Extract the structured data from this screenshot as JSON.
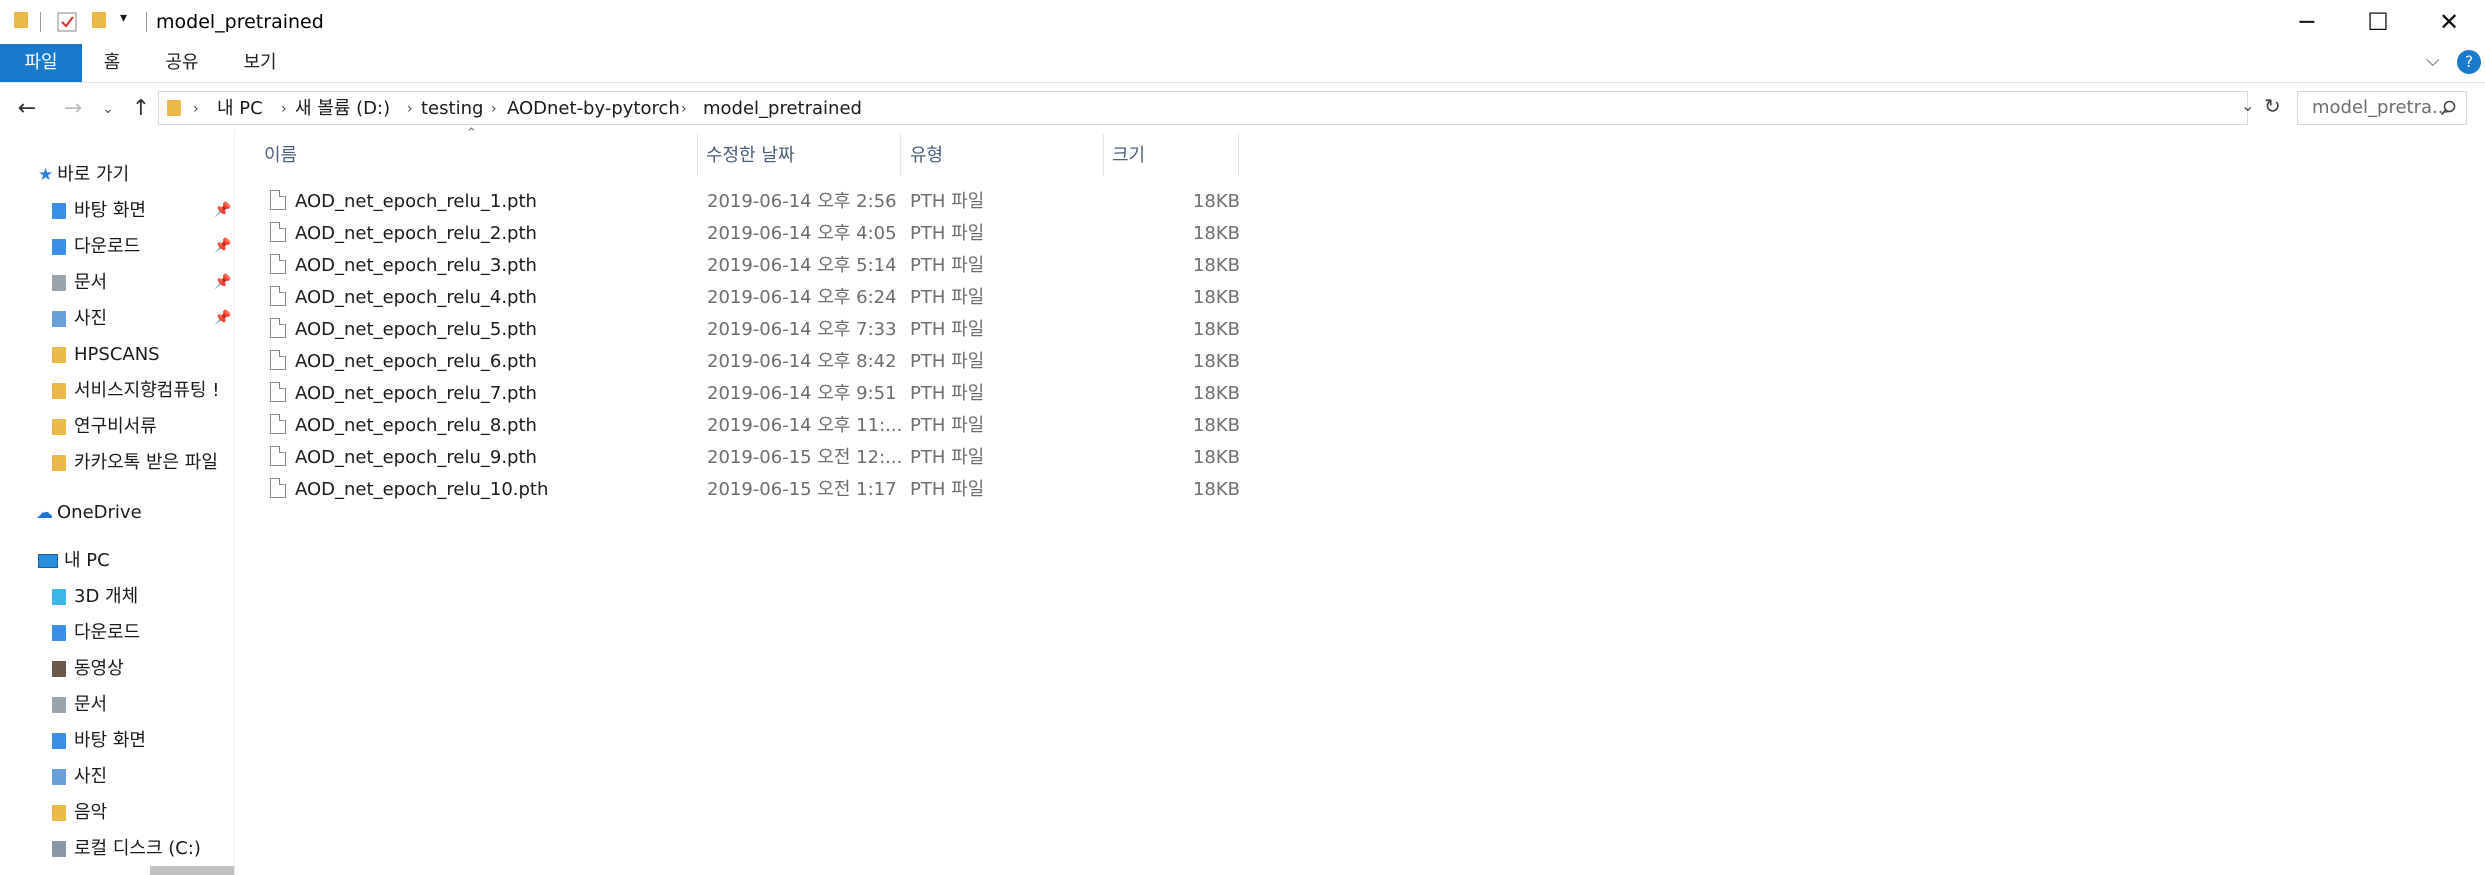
{
  "window": {
    "title": "model_pretrained"
  },
  "ribbon": {
    "tabs": [
      "파일",
      "홈",
      "공유",
      "보기"
    ]
  },
  "address": {
    "path": [
      "내 PC",
      "새 볼륨 (D:)",
      "testing",
      "AODnet-by-pytorch",
      "model_pretrained"
    ]
  },
  "search": {
    "placeholder": "model_pretra..."
  },
  "sidebar": {
    "quick_access_label": "바로 가기",
    "quick_items": [
      "바탕 화면",
      "다운로드",
      "문서",
      "사진",
      "HPSCANS",
      "서비스지향컴퓨팅 !",
      "연구비서류",
      "카카오톡 받은 파일"
    ],
    "onedrive_label": "OneDrive",
    "pc_label": "내 PC",
    "pc_items": [
      "3D 개체",
      "다운로드",
      "동영상",
      "문서",
      "바탕 화면",
      "사진",
      "음악",
      "로컬 디스크 (C:)"
    ]
  },
  "columns": {
    "name": "이름",
    "date": "수정한 날짜",
    "type": "유형",
    "size": "크기"
  },
  "files": [
    {
      "name": "AOD_net_epoch_relu_1.pth",
      "date": "2019-06-14 오후 2:56",
      "type": "PTH 파일",
      "size": "18KB"
    },
    {
      "name": "AOD_net_epoch_relu_2.pth",
      "date": "2019-06-14 오후 4:05",
      "type": "PTH 파일",
      "size": "18KB"
    },
    {
      "name": "AOD_net_epoch_relu_3.pth",
      "date": "2019-06-14 오후 5:14",
      "type": "PTH 파일",
      "size": "18KB"
    },
    {
      "name": "AOD_net_epoch_relu_4.pth",
      "date": "2019-06-14 오후 6:24",
      "type": "PTH 파일",
      "size": "18KB"
    },
    {
      "name": "AOD_net_epoch_relu_5.pth",
      "date": "2019-06-14 오후 7:33",
      "type": "PTH 파일",
      "size": "18KB"
    },
    {
      "name": "AOD_net_epoch_relu_6.pth",
      "date": "2019-06-14 오후 8:42",
      "type": "PTH 파일",
      "size": "18KB"
    },
    {
      "name": "AOD_net_epoch_relu_7.pth",
      "date": "2019-06-14 오후 9:51",
      "type": "PTH 파일",
      "size": "18KB"
    },
    {
      "name": "AOD_net_epoch_relu_8.pth",
      "date": "2019-06-14 오후 11:...",
      "type": "PTH 파일",
      "size": "18KB"
    },
    {
      "name": "AOD_net_epoch_relu_9.pth",
      "date": "2019-06-15 오전 12:...",
      "type": "PTH 파일",
      "size": "18KB"
    },
    {
      "name": "AOD_net_epoch_relu_10.pth",
      "date": "2019-06-15 오전 1:17",
      "type": "PTH 파일",
      "size": "18KB"
    }
  ]
}
